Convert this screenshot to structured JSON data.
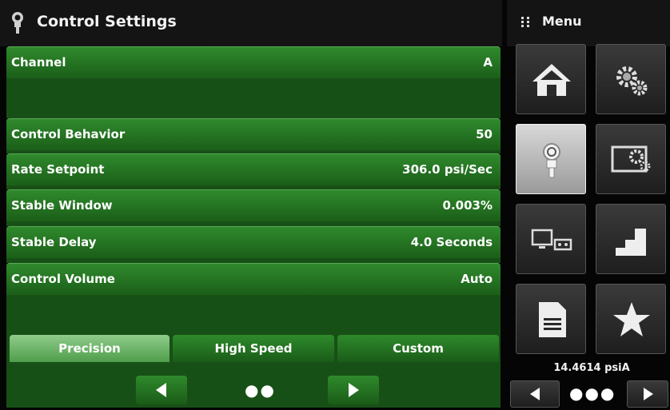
{
  "header": {
    "title": "Control Settings",
    "icon": "pressure-gauge-icon"
  },
  "menu": {
    "label": "Menu",
    "icon": "grid-dots-icon"
  },
  "rows": {
    "channel": {
      "label": "Channel",
      "value": "A"
    },
    "control_behavior": {
      "label": "Control Behavior",
      "value": "50"
    },
    "rate_setpoint": {
      "label": "Rate Setpoint",
      "value": "306.0 psi/Sec"
    },
    "stable_window": {
      "label": "Stable Window",
      "value": "0.003%"
    },
    "stable_delay": {
      "label": "Stable Delay",
      "value": "4.0 Seconds"
    },
    "control_volume": {
      "label": "Control Volume",
      "value": "Auto"
    }
  },
  "modes": {
    "items": [
      "Precision",
      "High Speed",
      "Custom"
    ],
    "selected": "Precision"
  },
  "nav": {
    "page_dots": "●●",
    "menu_dots": "●●●"
  },
  "reading": {
    "value": "14.4614 psiA"
  },
  "menu_tiles": [
    {
      "icon": "home-icon",
      "active": false
    },
    {
      "icon": "settings-gears-icon",
      "active": false
    },
    {
      "icon": "pressure-transducer-icon",
      "active": true
    },
    {
      "icon": "display-settings-icon",
      "active": false
    },
    {
      "icon": "remote-communication-icon",
      "active": false
    },
    {
      "icon": "step-program-icon",
      "active": false
    },
    {
      "icon": "document-icon",
      "active": false
    },
    {
      "icon": "favorite-star-icon",
      "active": false
    }
  ],
  "colors": {
    "green_row": "#2f8a2c",
    "green_fill": "#175016",
    "selected_mode": "#8fcc8b",
    "background": "#050505"
  }
}
